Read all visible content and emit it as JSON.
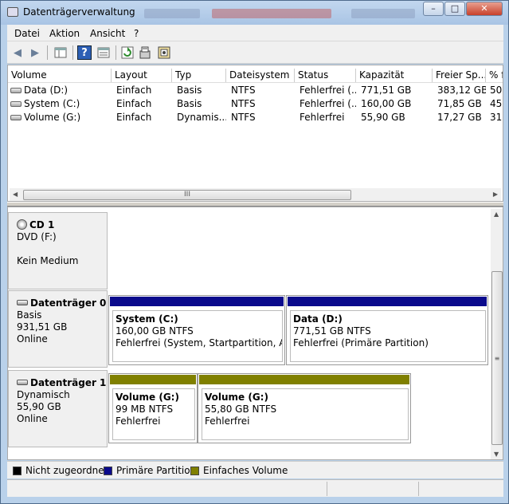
{
  "window": {
    "title": "Datenträgerverwaltung",
    "minimize": "–",
    "maximize": "□",
    "close": "✕"
  },
  "menu": [
    "Datei",
    "Aktion",
    "Ansicht",
    "?"
  ],
  "toolbar": {
    "back": "◀",
    "forward": "▶",
    "help": "?"
  },
  "volumes": {
    "columns": [
      "Volume",
      "Layout",
      "Typ",
      "Dateisystem",
      "Status",
      "Kapazität",
      "Freier Sp...",
      "% f"
    ],
    "rows": [
      [
        "Data (D:)",
        "Einfach",
        "Basis",
        "NTFS",
        "Fehlerfrei (...",
        "771,51 GB",
        "383,12 GB",
        "50"
      ],
      [
        "System (C:)",
        "Einfach",
        "Basis",
        "NTFS",
        "Fehlerfrei (...",
        "160,00 GB",
        "71,85 GB",
        "45"
      ],
      [
        "Volume (G:)",
        "Einfach",
        "Dynamis...",
        "NTFS",
        "Fehlerfrei",
        "55,90 GB",
        "17,27 GB",
        "31"
      ]
    ],
    "scroll_grip": "III"
  },
  "disks": [
    {
      "name": "CD 1",
      "lines": [
        "DVD (F:)",
        "",
        "Kein Medium"
      ],
      "partitions": []
    },
    {
      "name": "Datenträger 0",
      "lines": [
        "Basis",
        "931,51 GB",
        "Online"
      ],
      "partitions": [
        {
          "name": "System  (C:)",
          "size": "160,00 GB NTFS",
          "status": "Fehlerfrei (System, Startpartition, Auslag",
          "color": "#0a0a8c"
        },
        {
          "name": "Data  (D:)",
          "size": "771,51 GB NTFS",
          "status": "Fehlerfrei (Primäre Partition)",
          "color": "#0a0a8c"
        }
      ]
    },
    {
      "name": "Datenträger 1",
      "lines": [
        "Dynamisch",
        "55,90 GB",
        "Online"
      ],
      "partitions": [
        {
          "name": "Volume  (G:)",
          "size": "99 MB NTFS",
          "status": "Fehlerfrei",
          "color": "#808000"
        },
        {
          "name": "Volume  (G:)",
          "size": "55,80 GB NTFS",
          "status": "Fehlerfrei",
          "color": "#808000"
        }
      ]
    }
  ],
  "legend": [
    {
      "label": "Nicht zugeordnet",
      "color": "#000000"
    },
    {
      "label": "Primäre Partition",
      "color": "#0a0a8c"
    },
    {
      "label": "Einfaches Volume",
      "color": "#808000"
    }
  ]
}
